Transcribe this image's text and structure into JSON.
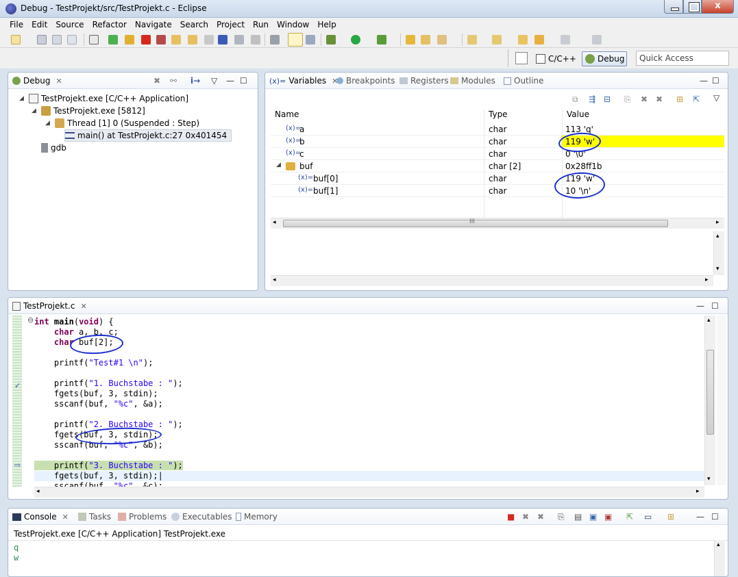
{
  "window": {
    "title": "Debug - TestProjekt/src/TestProjekt.c - Eclipse",
    "close_glyph": "x"
  },
  "menu": [
    "File",
    "Edit",
    "Source",
    "Refactor",
    "Navigate",
    "Search",
    "Project",
    "Run",
    "Window",
    "Help"
  ],
  "perspectives": {
    "cc_label": "C/C++",
    "debug_label": "Debug",
    "quick_access": "Quick Access"
  },
  "debug_view": {
    "tab": "Debug",
    "tree": [
      {
        "label": "TestProjekt.exe [C/C++ Application]"
      },
      {
        "label": "TestProjekt.exe [5812]"
      },
      {
        "label": "Thread [1] 0 (Suspended : Step)"
      },
      {
        "label": "main() at TestProjekt.c:27 0x401454"
      },
      {
        "label": "gdb"
      }
    ]
  },
  "variables_view": {
    "tabs": [
      "Variables",
      "Breakpoints",
      "Registers",
      "Modules",
      "Outline"
    ],
    "columns": [
      "Name",
      "Type",
      "Value"
    ],
    "rows": [
      {
        "name": "a",
        "type": "char",
        "value": "113 'q'"
      },
      {
        "name": "b",
        "type": "char",
        "value": "119 'w'"
      },
      {
        "name": "c",
        "type": "char",
        "value": "0 '\\0'"
      },
      {
        "name": "buf",
        "type": "char [2]",
        "value": "0x28ff1b"
      },
      {
        "name": "buf[0]",
        "type": "char",
        "value": "119 'w'"
      },
      {
        "name": "buf[1]",
        "type": "char",
        "value": "10 '\\n'"
      }
    ],
    "var_prefix": "(x)=",
    "scroll_grip": "III"
  },
  "editor": {
    "tab": "TestProjekt.c",
    "lines": [
      "int main(void) {",
      "    char a, b, c;",
      "    char buf[2];",
      "",
      "    printf(\"Test#1 \\n\");",
      "",
      "    printf(\"1. Buchstabe : \");",
      "    fgets(buf, 3, stdin);",
      "    sscanf(buf, \"%c\", &a);",
      "",
      "    printf(\"2. Buchstabe : \");",
      "    fgets(buf, 3, stdin);",
      "    sscanf(buf, \"%c\", &b);",
      "",
      "    printf(\"3. Buchstabe : \");",
      "    fgets(buf, 3, stdin);",
      "    sscanf(buf, \"%c\", &c);"
    ]
  },
  "console_view": {
    "tabs": [
      "Console",
      "Tasks",
      "Problems",
      "Executables",
      "Memory"
    ],
    "process_label": "TestProjekt.exe [C/C++ Application] TestProjekt.exe",
    "output": [
      "q",
      "w"
    ]
  },
  "colors": {
    "changed_value_highlight": "#ffff00",
    "annotation_ink": "#1a2fd0",
    "current_line": "#c8e0b0"
  }
}
